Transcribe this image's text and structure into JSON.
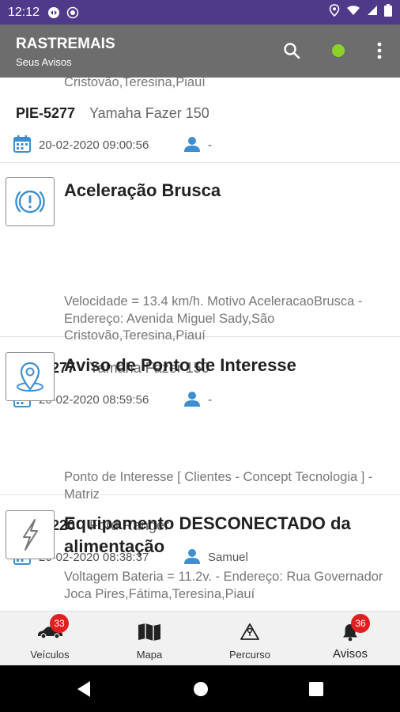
{
  "status_bar": {
    "time": "12:12"
  },
  "app_bar": {
    "title": "RASTREMAIS",
    "subtitle": "Seus Avisos",
    "status_color": "#8bd12a"
  },
  "alerts": [
    {
      "desc_line": "Cristovão,Teresina,Piauí",
      "plate": "PIE-5277",
      "vehicle": "Yamaha Fazer 150",
      "date": "20-02-2020 09:00:56",
      "user": "-"
    },
    {
      "icon": "warning-circle-icon",
      "title": "Aceleração Brusca",
      "description": "Velocidade = 13.4 km/h. Motivo AceleracaoBrusca - Endereço: Avenida Miguel Sady,São Cristovão,Teresina,Piauí",
      "plate": "PIE-5277",
      "vehicle": "Yamaha Fazer 150",
      "date": "20-02-2020 08:59:56",
      "user": "-"
    },
    {
      "icon": "map-pin-icon",
      "title": "Aviso de Ponto de Interesse",
      "description": "Ponto de Interesse [  Clientes - Concept Tecnologia ] - Matriz",
      "plate": "PIX-4220",
      "vehicle": "Ford Ranger",
      "date": "20-02-2020 08:38:37",
      "user": "Samuel"
    },
    {
      "icon": "lightning-icon",
      "title": "Equipamento DESCONECTADO da alimentação",
      "description": "Voltagem Bateria = 11.2v. - Endereço: Rua Governador Joca Pires,Fátima,Teresina,Piauí"
    }
  ],
  "bottom_nav": [
    {
      "label": "Veículos",
      "badge": "33"
    },
    {
      "label": "Mapa"
    },
    {
      "label": "Percurso"
    },
    {
      "label": "Avisos",
      "badge": "36"
    }
  ],
  "colors": {
    "accent_blue": "#3d8fd1",
    "app_bar": "#6d6d6d",
    "status_bar": "#4f3a8a",
    "badge": "#e02020"
  }
}
